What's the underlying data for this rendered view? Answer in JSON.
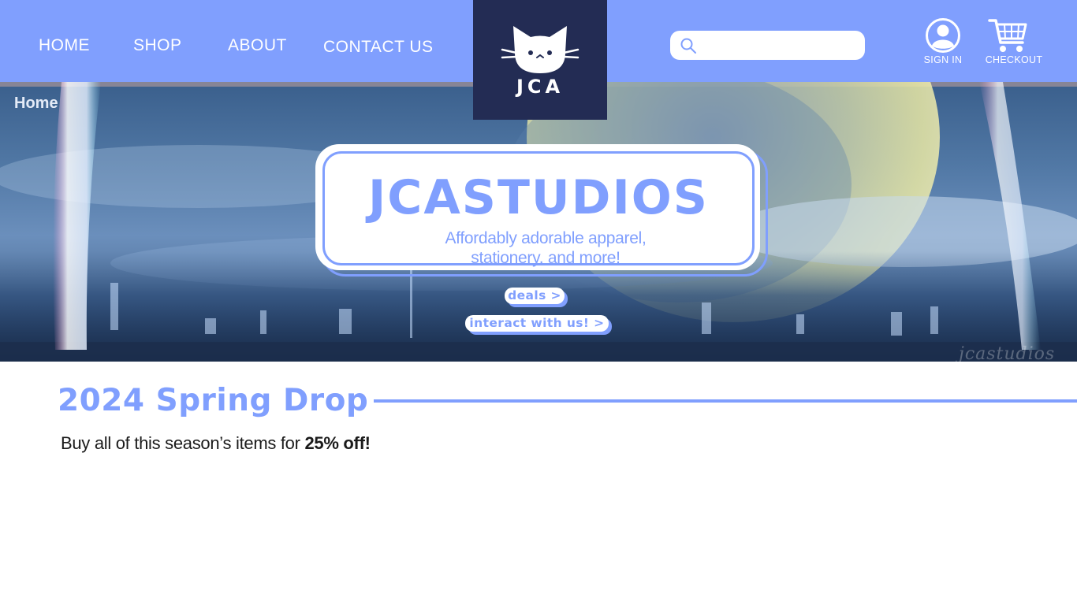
{
  "nav": {
    "items": [
      "HOME",
      "SHOP",
      "ABOUT",
      "CONTACT US"
    ],
    "logo_text": "JCA",
    "search": {
      "placeholder": ""
    },
    "sign_in_label": "SIGN IN",
    "checkout_label": "CHECKOUT"
  },
  "hero": {
    "breadcrumb": "Home",
    "title": "JCASTUDIOS",
    "tagline_line1": "Affordably adorable apparel,",
    "tagline_line2": "stationery, and more!",
    "deals_button": "deals >",
    "interact_button": "interact with us! >",
    "watermark": "jcastudios"
  },
  "section": {
    "title": "2024 Spring Drop",
    "promo_text": "Buy all of this season’s items for ",
    "promo_bold": "25% off!"
  },
  "icons": {
    "search": "search-icon",
    "user": "user-icon",
    "cart": "cart-icon",
    "logo": "cat-logo-icon"
  },
  "colors": {
    "nav_bg": "#809ffe",
    "logo_bg": "#232c54",
    "accent": "#809ffe",
    "text_dark": "#1b1b1b",
    "white": "#ffffff"
  }
}
